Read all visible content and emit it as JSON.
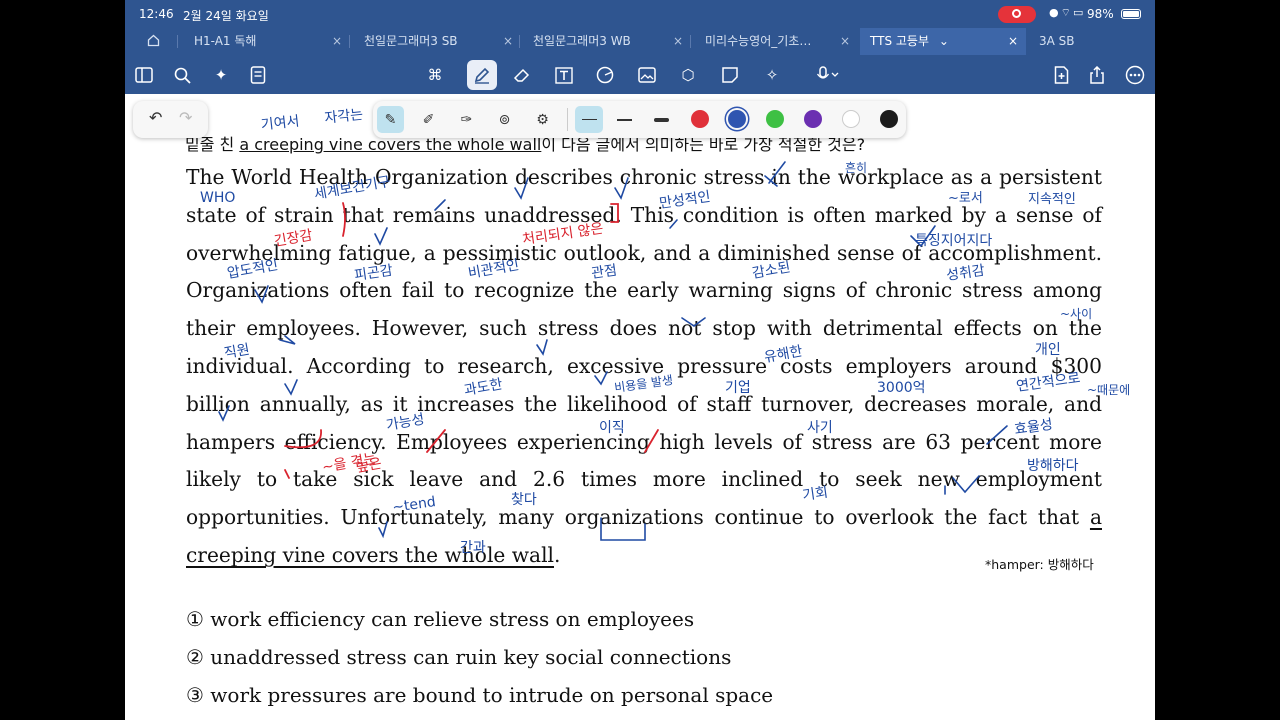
{
  "status": {
    "time": "12:46",
    "date": "2월 24일 화요일",
    "battery": "98%"
  },
  "tabs": [
    {
      "label": "H1-A1 독해"
    },
    {
      "label": "천일문그래머3 SB"
    },
    {
      "label": "천일문그래머3 WB"
    },
    {
      "label": "미리수능영어_기초…"
    },
    {
      "label": "TTS 고등부",
      "active": true
    },
    {
      "label": "3A SB"
    }
  ],
  "tab_close": "×",
  "active_tab_chevron": "⌄",
  "question": {
    "prefix": "밑줄 친 ",
    "underlined": "a creeping vine covers the whole wall",
    "suffix": "이 다음 글에서 의미하는 바로 가장 적절한 것은?"
  },
  "passage": {
    "body": "The World Health Organization describes chronic stress in the workplace as a persistent state of strain that remains unaddressed. This condition is often marked by a sense of overwhelming fatigue, a pessimistic outlook, and a diminished sense of accomplishment. Organizations often fail to recognize the early warning signs of chronic stress among their employees. However, such stress does not stop with detrimental effects on the individual. According to research, excessive pressure costs employers around $300 billion annually, as it increases the likelihood of staff turnover, decreases morale, and hampers efficiency. Employees experiencing high levels of stress are 63 percent more likely to take sick leave and 2.6 times more inclined to seek new employment opportunities. Unfortunately, many organizations continue to overlook the fact that ",
    "target": "a creeping vine covers the whole wall",
    "end": "."
  },
  "footnote": "*hamper: 방해하다",
  "options": [
    "① work efficiency can relieve stress on employees",
    "② unaddressed stress can ruin key social connections",
    "③ work pressures are bound to intrude on personal space"
  ],
  "annotations": {
    "blue": [
      "기여서",
      "자각는",
      "WHO",
      "세계보건기구",
      "만성적인",
      "~로서",
      "지속적인",
      "흔히",
      "특징지어지다",
      "압도적인",
      "피곤감",
      "비관적인",
      "관점",
      "감소된",
      "성취감",
      "~사이",
      "직원",
      "유해한",
      "개인",
      "연간적으로",
      "~때문에",
      "과도한",
      "비용을 발생",
      "기업",
      "3000억",
      "이직",
      "사기",
      "가능성",
      "효율성",
      "방해하다",
      "~tend",
      "찾다",
      "기회",
      "간과"
    ],
    "red": [
      "긴장감",
      "처리되지 않은",
      "~을 겪는",
      "높은"
    ],
    "ink_colors": {
      "blue": "#1f4aa3",
      "red": "#d9232e"
    }
  },
  "pen_colors": [
    "#e0313a",
    "#2f55b0",
    "#3ec044",
    "#6b2fb1",
    "#ffffff",
    "#1b1b1b"
  ]
}
